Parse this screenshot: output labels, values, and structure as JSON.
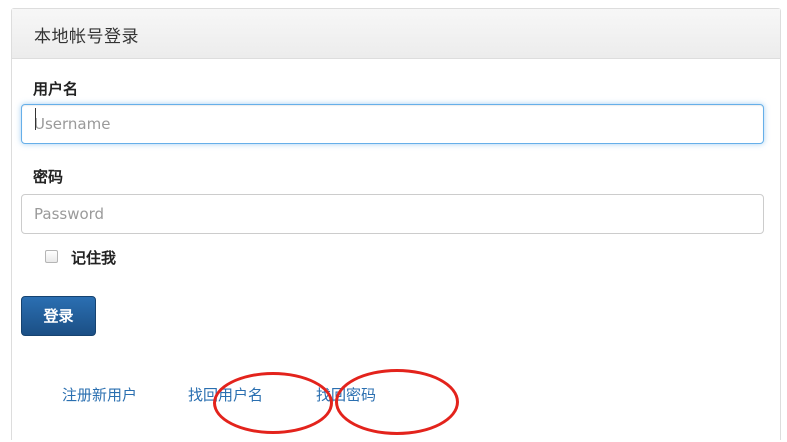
{
  "panel": {
    "title": "本地帐号登录"
  },
  "form": {
    "username_label": "用户名",
    "username_placeholder": "Username",
    "username_value": "",
    "password_label": "密码",
    "password_placeholder": "Password",
    "password_value": "",
    "remember_label": "记住我",
    "remember_checked": false,
    "submit_label": "登录"
  },
  "links": {
    "register": "注册新用户",
    "find_username": "找回用户名",
    "find_password": "找回密码"
  },
  "colors": {
    "primary_button": "#1f5a96",
    "link": "#2a6fb0",
    "focus_border": "#66afe9",
    "annotation": "#e3231c"
  }
}
